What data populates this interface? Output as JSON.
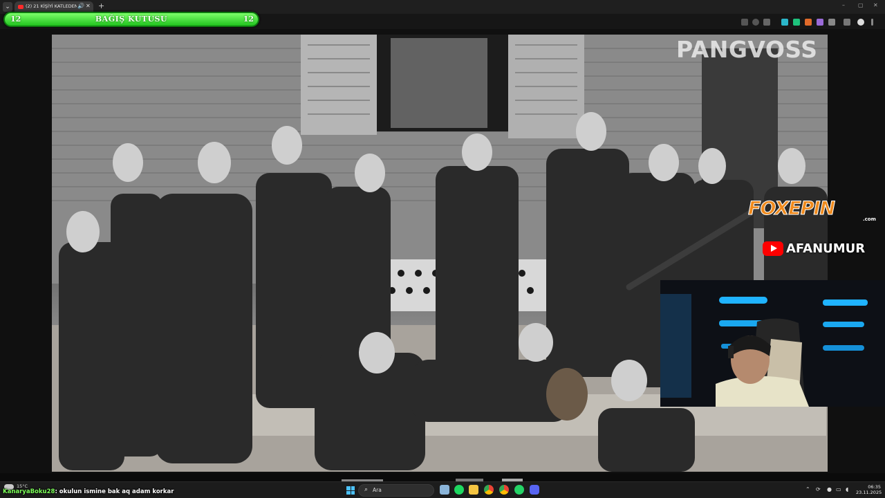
{
  "browser": {
    "tab_title": "(2) 21 KİŞİYİ KATLEDEN OT...",
    "tab_menu_icon": "chevron-down-icon",
    "new_tab_label": "+",
    "window_controls": [
      "–",
      "▢",
      "✕"
    ]
  },
  "donation_bar": {
    "title": "BAĞIŞ KUTUSU",
    "left_number": "12",
    "right_number": "12",
    "fill_fraction": 1.0,
    "colors": {
      "fill": "#3fd83a",
      "border": "#0e7a10"
    }
  },
  "video": {
    "channel_watermark": "PANGVOSS",
    "sponsor_logo_text": "FOXEPIN",
    "sponsor_logo_subtext": ".com",
    "youtube_handle": "AFANUMUR",
    "colors": {
      "sponsor": "#f08a1c",
      "youtube": "#ff0000"
    }
  },
  "chat": {
    "username": "KanaryaBoku28",
    "message": ": okulun ismine bak aq adam korkar"
  },
  "taskbar": {
    "weather": "15°C",
    "search_label": "Ara",
    "clock_time": "06:35",
    "clock_date": "23.11.2025",
    "apps": [
      "file-explorer-icon",
      "spotify-icon",
      "folder-icon",
      "chrome-icon",
      "chrome-alt-icon",
      "whatsapp-icon",
      "discord-icon"
    ]
  }
}
